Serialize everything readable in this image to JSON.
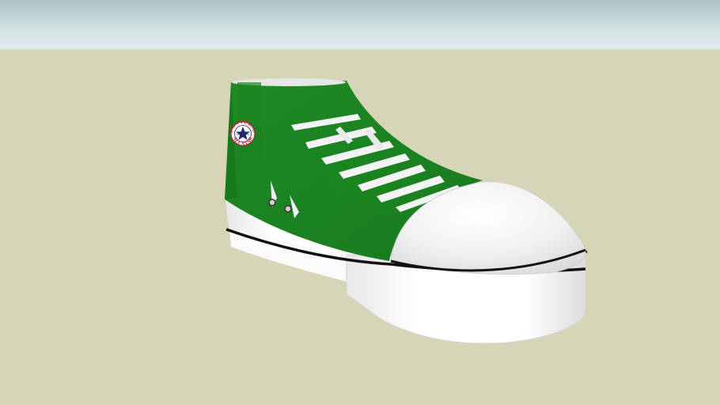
{
  "scene": {
    "sky_color": "#cfdfe1",
    "ground_color": "#d7d5b8"
  },
  "shoe": {
    "upper_color": "#1f8a25",
    "sole_color": "#ffffff",
    "stripe_color": "#111111",
    "lace_color": "#f4f4f4",
    "eyelet_count": 2,
    "lace_count": 7
  },
  "logo": {
    "top_text": "CONVERSE",
    "bottom_text": "ALL STAR",
    "signature": "Chuck Taylor",
    "star_icon": "star-icon"
  }
}
